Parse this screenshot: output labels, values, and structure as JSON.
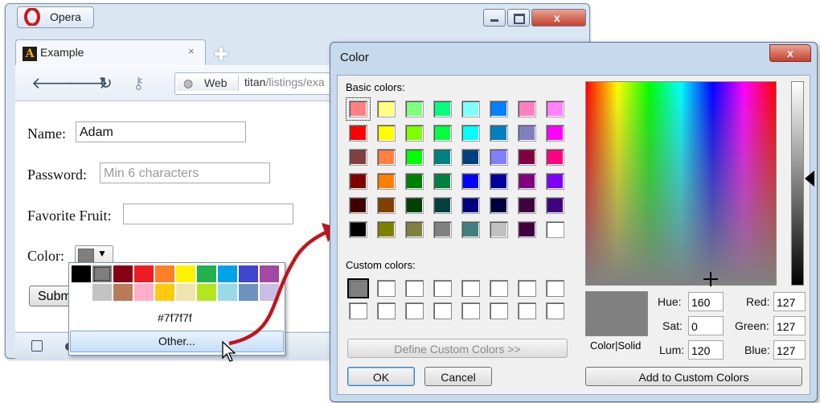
{
  "opera": {
    "app_name": "Opera",
    "tab_label": "Example",
    "tab_close": "×",
    "tab_icon_letter": "A",
    "address": {
      "web_label": "Web",
      "url_host": "titan",
      "url_path": "/listings/exa"
    }
  },
  "form": {
    "name_label": "Name:",
    "name_value": "Adam",
    "password_label": "Password:",
    "password_placeholder": "Min 6 characters",
    "fruit_label": "Favorite Fruit:",
    "fruit_value": "",
    "color_label": "Color:",
    "color_value": "#7f7f7f",
    "submit_label": "Subm"
  },
  "color_popup": {
    "row1": [
      "#000000",
      "#7f7f7f",
      "#880015",
      "#ed1c24",
      "#ff7f27",
      "#fff200",
      "#22b14c",
      "#00a2e8",
      "#3f48cc",
      "#a349a4"
    ],
    "row2": [
      "#ffffff",
      "#c3c3c3",
      "#b97a57",
      "#ffaec9",
      "#ffc90e",
      "#efe4b0",
      "#b5e61d",
      "#99d9ea",
      "#7092be",
      "#c8bfe7"
    ],
    "hex_label": "#7f7f7f",
    "other_label": "Other..."
  },
  "color_dialog": {
    "title": "Color",
    "close_glyph": "x",
    "basic_colors_label": "Basic colors:",
    "basic_colors": [
      [
        "#ff8080",
        "#ffff80",
        "#80ff80",
        "#00ff80",
        "#80ffff",
        "#0080ff",
        "#ff80c0",
        "#ff80ff"
      ],
      [
        "#ff0000",
        "#ffff00",
        "#80ff00",
        "#00ff40",
        "#00ffff",
        "#0080c0",
        "#8080c0",
        "#ff00ff"
      ],
      [
        "#804040",
        "#ff8040",
        "#00ff00",
        "#008080",
        "#004080",
        "#8080ff",
        "#800040",
        "#ff0080"
      ],
      [
        "#800000",
        "#ff8000",
        "#008000",
        "#008040",
        "#0000ff",
        "#0000a0",
        "#800080",
        "#8000ff"
      ],
      [
        "#400000",
        "#804000",
        "#004000",
        "#004040",
        "#000080",
        "#000040",
        "#400040",
        "#400080"
      ],
      [
        "#000000",
        "#808000",
        "#808040",
        "#808080",
        "#408080",
        "#c0c0c0",
        "#400040",
        "#ffffff"
      ]
    ],
    "custom_colors_label": "Custom colors:",
    "custom_first_color": "#808080",
    "define_custom_label": "Define Custom Colors >>",
    "ok_label": "OK",
    "cancel_label": "Cancel",
    "color_solid_label": "Color|Solid",
    "hue_label": "Hue:",
    "hue_value": "160",
    "sat_label": "Sat:",
    "sat_value": "0",
    "lum_label": "Lum:",
    "lum_value": "120",
    "red_label": "Red:",
    "red_value": "127",
    "green_label": "Green:",
    "green_value": "127",
    "blue_label": "Blue:",
    "blue_value": "127",
    "add_custom_label": "Add to Custom Colors",
    "preview_color": "#808080",
    "annotation_arrow_color": "#c0161c"
  }
}
